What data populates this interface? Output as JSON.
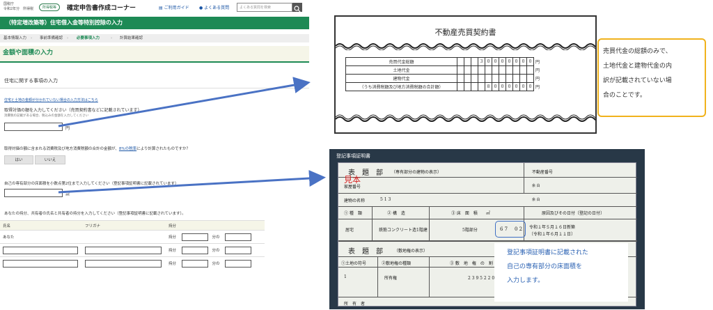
{
  "header": {
    "agency_small_1": "国税庁",
    "agency_small_2": "令和2年分　所得税",
    "badge": "所得税等",
    "title": "確定申告書作成コーナー",
    "guide_link": "ご利用ガイド",
    "faq_link": "よくある質問",
    "search_placeholder": "よくある質問を検索"
  },
  "green_title": "（特定増改築等）住宅借入金等特別控除の入力",
  "steps": [
    "基本情報入力",
    "事前準備確認",
    "必要事項入力",
    "計算結果確認"
  ],
  "section_title": "金額や面積の入力",
  "subsection": "住宅に関する事項の入力",
  "form": {
    "link_text": "住宅と土地の金額が分かれていない場合の入力方法はこちら",
    "q1": "取得対価の額を入力してください（売買契約書などに記載されています）",
    "q1_note": "消費税の記載がある場合、税込みの金額を入力してください",
    "unit_yen": "円",
    "q2_prefix": "取得対価の額に含まれる消費税及び地方消費税額の合計の金額が、",
    "q2_link": "8%の税率",
    "q2_suffix": "により計算されたものですか？",
    "yes": "はい",
    "no": "いいえ",
    "q3": "自己の専有部分の床面積を小数点第2位まで入力してください（登記事項証明書に記載されています）",
    "unit_sqm": "㎡",
    "q4": "あなたの持分、共有者の氏名と共有者の持分を入力してください（登記事項証明書に記載されています）。",
    "table_headers": [
      "氏名",
      "フリガナ",
      "持分"
    ],
    "row1_name": "あなた",
    "share_label": "持分",
    "share_of": "分の"
  },
  "contract_doc": {
    "title": "不動産売買契約書",
    "rows": [
      {
        "label": "売買代金総額",
        "digits": [
          "",
          "",
          "",
          "3",
          "0",
          "0",
          "0",
          "0",
          "0",
          "0",
          "0"
        ]
      },
      {
        "label": "土地代金",
        "digits": [
          "",
          "",
          "",
          "",
          "",
          "",
          "",
          "",
          "",
          "",
          ""
        ]
      },
      {
        "label": "建物代金",
        "digits": [
          "",
          "",
          "",
          "",
          "",
          "",
          "",
          "",
          "",
          "",
          ""
        ]
      },
      {
        "label": "（うち消費税額及び地方消費税額の合計額）",
        "digits": [
          "",
          "",
          "",
          "",
          "8",
          "0",
          "0",
          "0",
          "0",
          "0",
          "0"
        ]
      }
    ],
    "yen": "円"
  },
  "callout1": [
    "売買代金の総額のみで、",
    "土地代金と建物代金の内",
    "訳が記載されていない場",
    "合のことです。"
  ],
  "register": {
    "window_title": "登記事項証明書",
    "hyodai": "表　題　部",
    "hyodai_sub": "（専有部分の建物の表示）",
    "fudosan_no": "不動産番号",
    "stamp": "見本",
    "kaoku_no": "家屋番号",
    "yohaku1": "余 白",
    "tatemono_name": "建物の名称",
    "tatemono_value": "5 1 3",
    "yohaku2": "余 白",
    "col1": "① 種　類",
    "col2": "② 構　造",
    "col3": "③ 床　面　積　　㎡",
    "col4": "原因及びその日付〔登記の日付〕",
    "type_val": "居宅",
    "struct_val": "鉄筋コンクリート造1階建",
    "floor_val": "5階部分",
    "area_int": "6 7",
    "area_dec": "0 2",
    "date1": "令和１年５月１６日新築",
    "date2": "〔令和１年６月１１日〕",
    "hyodai2": "表　題　部",
    "hyodai2_sub": "（敷地権の表示）",
    "land_col1": "①土地の符号",
    "land_col2": "②敷地権の種類",
    "land_col3": "③ 敷　地　権　の　割",
    "land_no": "1",
    "land_type": "所有権",
    "land_ratio": "2 3 9 5 2 2 0 分の",
    "owner": "所　有　者"
  },
  "callout2": [
    "登記事項証明書に記載された",
    "自己の専有部分の床面積を",
    "入力します。"
  ]
}
